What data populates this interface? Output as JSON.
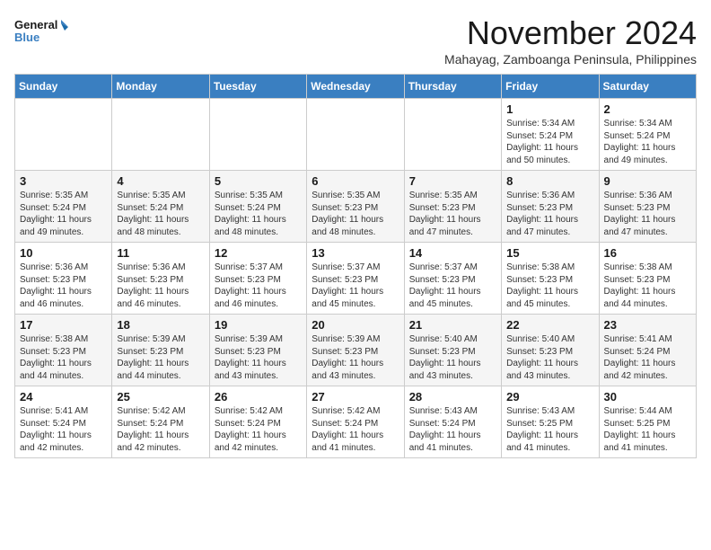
{
  "logo": {
    "line1": "General",
    "line2": "Blue"
  },
  "title": "November 2024",
  "location": "Mahayag, Zamboanga Peninsula, Philippines",
  "days_of_week": [
    "Sunday",
    "Monday",
    "Tuesday",
    "Wednesday",
    "Thursday",
    "Friday",
    "Saturday"
  ],
  "weeks": [
    [
      {
        "day": "",
        "info": ""
      },
      {
        "day": "",
        "info": ""
      },
      {
        "day": "",
        "info": ""
      },
      {
        "day": "",
        "info": ""
      },
      {
        "day": "",
        "info": ""
      },
      {
        "day": "1",
        "info": "Sunrise: 5:34 AM\nSunset: 5:24 PM\nDaylight: 11 hours\nand 50 minutes."
      },
      {
        "day": "2",
        "info": "Sunrise: 5:34 AM\nSunset: 5:24 PM\nDaylight: 11 hours\nand 49 minutes."
      }
    ],
    [
      {
        "day": "3",
        "info": "Sunrise: 5:35 AM\nSunset: 5:24 PM\nDaylight: 11 hours\nand 49 minutes."
      },
      {
        "day": "4",
        "info": "Sunrise: 5:35 AM\nSunset: 5:24 PM\nDaylight: 11 hours\nand 48 minutes."
      },
      {
        "day": "5",
        "info": "Sunrise: 5:35 AM\nSunset: 5:24 PM\nDaylight: 11 hours\nand 48 minutes."
      },
      {
        "day": "6",
        "info": "Sunrise: 5:35 AM\nSunset: 5:23 PM\nDaylight: 11 hours\nand 48 minutes."
      },
      {
        "day": "7",
        "info": "Sunrise: 5:35 AM\nSunset: 5:23 PM\nDaylight: 11 hours\nand 47 minutes."
      },
      {
        "day": "8",
        "info": "Sunrise: 5:36 AM\nSunset: 5:23 PM\nDaylight: 11 hours\nand 47 minutes."
      },
      {
        "day": "9",
        "info": "Sunrise: 5:36 AM\nSunset: 5:23 PM\nDaylight: 11 hours\nand 47 minutes."
      }
    ],
    [
      {
        "day": "10",
        "info": "Sunrise: 5:36 AM\nSunset: 5:23 PM\nDaylight: 11 hours\nand 46 minutes."
      },
      {
        "day": "11",
        "info": "Sunrise: 5:36 AM\nSunset: 5:23 PM\nDaylight: 11 hours\nand 46 minutes."
      },
      {
        "day": "12",
        "info": "Sunrise: 5:37 AM\nSunset: 5:23 PM\nDaylight: 11 hours\nand 46 minutes."
      },
      {
        "day": "13",
        "info": "Sunrise: 5:37 AM\nSunset: 5:23 PM\nDaylight: 11 hours\nand 45 minutes."
      },
      {
        "day": "14",
        "info": "Sunrise: 5:37 AM\nSunset: 5:23 PM\nDaylight: 11 hours\nand 45 minutes."
      },
      {
        "day": "15",
        "info": "Sunrise: 5:38 AM\nSunset: 5:23 PM\nDaylight: 11 hours\nand 45 minutes."
      },
      {
        "day": "16",
        "info": "Sunrise: 5:38 AM\nSunset: 5:23 PM\nDaylight: 11 hours\nand 44 minutes."
      }
    ],
    [
      {
        "day": "17",
        "info": "Sunrise: 5:38 AM\nSunset: 5:23 PM\nDaylight: 11 hours\nand 44 minutes."
      },
      {
        "day": "18",
        "info": "Sunrise: 5:39 AM\nSunset: 5:23 PM\nDaylight: 11 hours\nand 44 minutes."
      },
      {
        "day": "19",
        "info": "Sunrise: 5:39 AM\nSunset: 5:23 PM\nDaylight: 11 hours\nand 43 minutes."
      },
      {
        "day": "20",
        "info": "Sunrise: 5:39 AM\nSunset: 5:23 PM\nDaylight: 11 hours\nand 43 minutes."
      },
      {
        "day": "21",
        "info": "Sunrise: 5:40 AM\nSunset: 5:23 PM\nDaylight: 11 hours\nand 43 minutes."
      },
      {
        "day": "22",
        "info": "Sunrise: 5:40 AM\nSunset: 5:23 PM\nDaylight: 11 hours\nand 43 minutes."
      },
      {
        "day": "23",
        "info": "Sunrise: 5:41 AM\nSunset: 5:24 PM\nDaylight: 11 hours\nand 42 minutes."
      }
    ],
    [
      {
        "day": "24",
        "info": "Sunrise: 5:41 AM\nSunset: 5:24 PM\nDaylight: 11 hours\nand 42 minutes."
      },
      {
        "day": "25",
        "info": "Sunrise: 5:42 AM\nSunset: 5:24 PM\nDaylight: 11 hours\nand 42 minutes."
      },
      {
        "day": "26",
        "info": "Sunrise: 5:42 AM\nSunset: 5:24 PM\nDaylight: 11 hours\nand 42 minutes."
      },
      {
        "day": "27",
        "info": "Sunrise: 5:42 AM\nSunset: 5:24 PM\nDaylight: 11 hours\nand 41 minutes."
      },
      {
        "day": "28",
        "info": "Sunrise: 5:43 AM\nSunset: 5:24 PM\nDaylight: 11 hours\nand 41 minutes."
      },
      {
        "day": "29",
        "info": "Sunrise: 5:43 AM\nSunset: 5:25 PM\nDaylight: 11 hours\nand 41 minutes."
      },
      {
        "day": "30",
        "info": "Sunrise: 5:44 AM\nSunset: 5:25 PM\nDaylight: 11 hours\nand 41 minutes."
      }
    ]
  ]
}
